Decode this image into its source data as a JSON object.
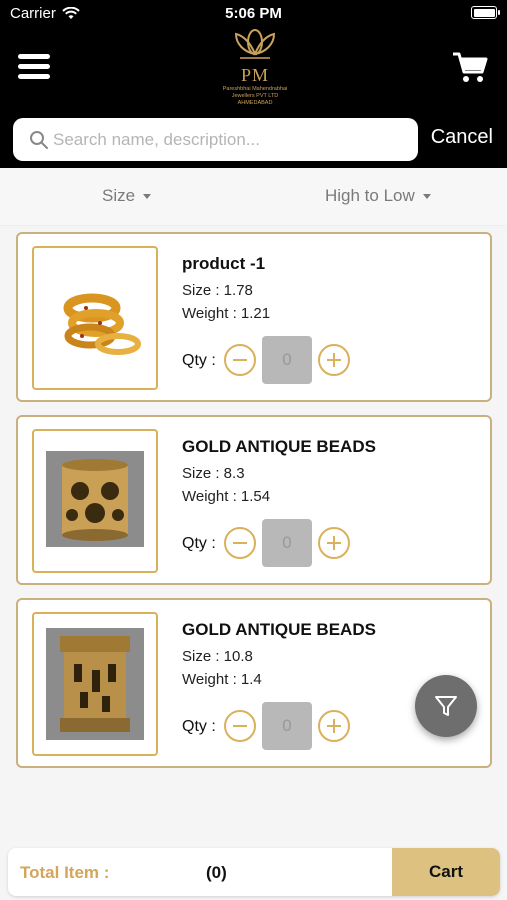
{
  "status_bar": {
    "carrier": "Carrier",
    "time": "5:06 PM"
  },
  "header": {
    "logo_text": "PM",
    "logo_subtitle_1": "Pareshbhai Mahendrabhai",
    "logo_subtitle_2": "Jewellers PVT LTD",
    "logo_subtitle_3": "AHMEDABAD"
  },
  "search": {
    "placeholder": "Search name, description...",
    "value": "",
    "cancel_label": "Cancel"
  },
  "filters": {
    "size_label": "Size",
    "sort_label": "High to Low"
  },
  "products": [
    {
      "name": "product -1",
      "size": "Size : 1.78",
      "weight": "Weight : 1.21",
      "qty_label": "Qty :",
      "qty": "0",
      "image_icon": "bangles-icon"
    },
    {
      "name": "GOLD ANTIQUE BEADS",
      "size": "Size : 8.3",
      "weight": "Weight : 1.54",
      "qty_label": "Qty :",
      "qty": "0",
      "image_icon": "bead-icon"
    },
    {
      "name": "GOLD ANTIQUE BEADS",
      "size": "Size : 10.8",
      "weight": "Weight : 1.4",
      "qty_label": "Qty :",
      "qty": "0",
      "image_icon": "bead-icon"
    }
  ],
  "footer": {
    "total_label": "Total Item :",
    "total_count": "(0)",
    "cart_label": "Cart"
  },
  "colors": {
    "accent_gold": "#d9b15c",
    "cart_button": "#dcc180",
    "header_bg": "#000000"
  }
}
